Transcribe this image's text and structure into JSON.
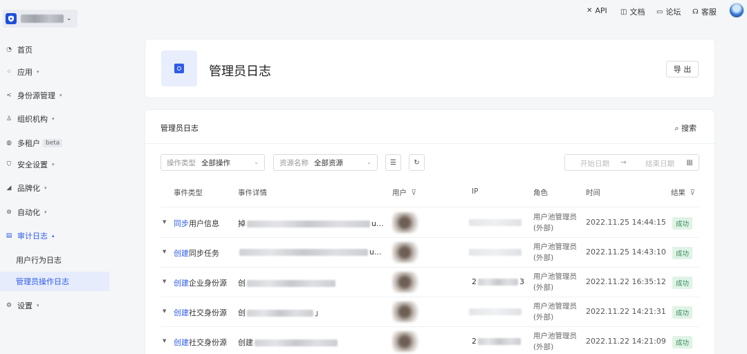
{
  "sidebar": {
    "items": [
      {
        "label": "首页",
        "icon": "pie-chart-icon"
      },
      {
        "label": "应用",
        "icon": "apps-icon"
      },
      {
        "label": "身份源管理",
        "icon": "share-icon"
      },
      {
        "label": "组织机构",
        "icon": "org-icon"
      },
      {
        "label": "多租户",
        "icon": "tenant-icon",
        "badge": "beta"
      },
      {
        "label": "安全设置",
        "icon": "shield-icon"
      },
      {
        "label": "品牌化",
        "icon": "brand-icon"
      },
      {
        "label": "自动化",
        "icon": "automation-icon"
      },
      {
        "label": "审计日志",
        "icon": "audit-log-icon"
      },
      {
        "label": "设置",
        "icon": "gear-icon"
      }
    ],
    "sub_items": [
      {
        "label": "用户行为日志"
      },
      {
        "label": "管理员操作日志"
      }
    ]
  },
  "topbar": {
    "links": [
      {
        "label": "API",
        "icon": "api-icon"
      },
      {
        "label": "文档",
        "icon": "book-icon"
      },
      {
        "label": "论坛",
        "icon": "forum-icon"
      },
      {
        "label": "客服",
        "icon": "headset-icon"
      }
    ]
  },
  "header": {
    "title": "管理员日志",
    "export_label": "导 出"
  },
  "log_panel": {
    "title": "管理员日志",
    "search_label": "搜索",
    "filter_type": {
      "label": "操作类型",
      "value": "全部操作"
    },
    "filter_resource": {
      "label": "资源名称",
      "value": "全部资源"
    },
    "date_start_placeholder": "开始日期",
    "date_arrow": "→",
    "date_end_placeholder": "结束日期"
  },
  "table": {
    "headers": [
      "事件类型",
      "事件详情",
      "用户",
      "IP",
      "角色",
      "时间",
      "结果"
    ],
    "rows": [
      {
        "verb": "同步",
        "object": "用户信息",
        "detail_prefix": "掉",
        "detail_suffix": "u...",
        "ip_prefix": "",
        "ip_suffix": "",
        "role_line1": "用户池管理员",
        "role_line2": "(外部)",
        "time": "2022.11.25 14:44:15",
        "result": "成功"
      },
      {
        "verb": "创建",
        "object": "同步任务",
        "detail_prefix": "",
        "detail_suffix": "u...",
        "ip_prefix": "",
        "ip_suffix": "",
        "role_line1": "用户池管理员",
        "role_line2": "(外部)",
        "time": "2022.11.25 14:43:10",
        "result": "成功"
      },
      {
        "verb": "创建",
        "object": "企业身份源",
        "detail_prefix": "创",
        "detail_suffix": "",
        "ip_prefix": "2",
        "ip_suffix": "3",
        "role_line1": "用户池管理员",
        "role_line2": "(外部)",
        "time": "2022.11.22 16:35:12",
        "result": "成功"
      },
      {
        "verb": "创建",
        "object": "社交身份源",
        "detail_prefix": "创",
        "detail_suffix": "」",
        "ip_prefix": "",
        "ip_suffix": "",
        "role_line1": "用户池管理员",
        "role_line2": "(外部)",
        "time": "2022.11.22 14:21:31",
        "result": "成功"
      },
      {
        "verb": "创建",
        "object": "社交身份源",
        "detail_prefix": "创建",
        "detail_suffix": "",
        "ip_prefix": "2",
        "ip_suffix": "",
        "role_line1": "用户池管理员",
        "role_line2": "(外部)",
        "time": "2022.11.22 14:21:09",
        "result": "成功"
      }
    ]
  },
  "colors": {
    "accent": "#2f5bea",
    "success_text": "#3a8a5b",
    "success_bg": "#dff3e6"
  }
}
